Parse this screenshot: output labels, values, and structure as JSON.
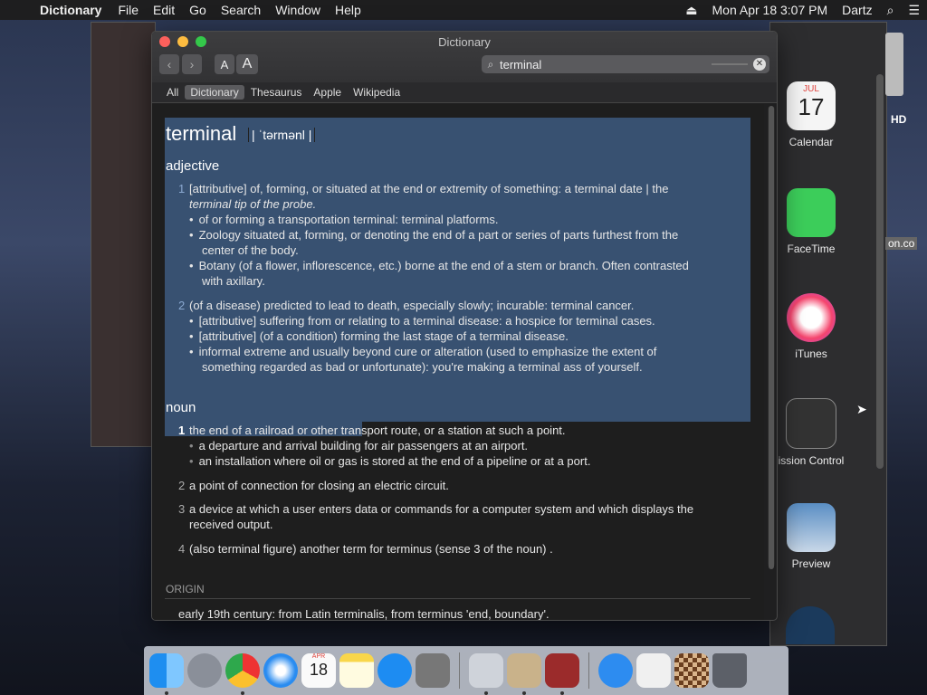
{
  "menubar": {
    "app_name": "Dictionary",
    "menus": [
      "File",
      "Edit",
      "Go",
      "Search",
      "Window",
      "Help"
    ],
    "datetime": "Mon Apr 18  3:07 PM",
    "user": "Dartz"
  },
  "window": {
    "title": "Dictionary",
    "font_small": "A",
    "font_large": "A",
    "search_value": "terminal",
    "tabs": [
      "All",
      "Dictionary",
      "Thesaurus",
      "Apple",
      "Wikipedia"
    ]
  },
  "entry": {
    "headword": "terminal",
    "pronunciation": "| ˈtərmənl |",
    "adjective_label": "adjective",
    "adj_1_num": "1",
    "adj_1_a": "[attributive] of, forming, or situated at the end or extremity of something: a terminal date | the",
    "adj_1_b": "terminal tip of the probe.",
    "adj_1_s1": "of or forming a transportation terminal: terminal platforms.",
    "adj_1_s2a": "Zoology situated at, forming, or denoting the end of a part or series of parts furthest from the",
    "adj_1_s2b": "center of the body.",
    "adj_1_s3a": "Botany (of a flower, inflorescence, etc.) borne at the end of a stem or branch. Often contrasted",
    "adj_1_s3b": "with axillary.",
    "adj_2_num": "2",
    "adj_2_a": "(of a disease) predicted to lead to death, especially slowly; incurable: terminal cancer.",
    "adj_2_s1": "[attributive] suffering from or relating to a terminal disease: a hospice for terminal cases.",
    "adj_2_s2": "[attributive] (of a condition) forming the last stage of a terminal disease.",
    "adj_2_s3a": "informal extreme and usually beyond cure or alteration (used to emphasize the extent of",
    "adj_2_s3b": "something regarded as bad or unfortunate): you're making a terminal ass of yourself.",
    "noun_label": "noun",
    "n_1_num": "1",
    "n_1": "the end of a railroad or other transport route, or a station at such a point.",
    "n_1_s1": "a departure and arrival building for air passengers at an airport.",
    "n_1_s2": "an installation where oil or gas is stored at the end of a pipeline or at a port.",
    "n_2_num": "2",
    "n_2": "a point of connection for closing an electric circuit.",
    "n_3_num": "3",
    "n_3a": "a device at which a user enters data or commands for a computer system and which displays the",
    "n_3b": "received output.",
    "n_4_num": "4",
    "n_4": "(also terminal figure) another term for terminus (sense 3 of the noun) .",
    "origin_label": "ORIGIN",
    "origin": "early 19th century: from Latin terminalis, from terminus 'end, boundary'."
  },
  "apps_panel": [
    {
      "label": "Calendar",
      "icon": "calendar-icon",
      "calendar_month": "JUL",
      "calendar_day": "17"
    },
    {
      "label": "FaceTime",
      "icon": "facetime-icon"
    },
    {
      "label": "iTunes",
      "icon": "itunes-icon"
    },
    {
      "label": "ission Control",
      "icon": "mission-control-icon"
    },
    {
      "label": "Preview",
      "icon": "preview-icon"
    }
  ],
  "desktop": {
    "drive_label": "HD",
    "partial_label": "on.co"
  },
  "dock": {
    "calendar_month": "APR",
    "calendar_day": "18",
    "items": [
      "finder-icon",
      "launchpad-icon",
      "chrome-icon",
      "safari-icon",
      "calendar-icon",
      "notes-icon",
      "app-store-icon",
      "system-preferences-icon",
      "directory-utility-icon",
      "chess-icon",
      "dictionary-icon",
      "app-store-downloads-icon",
      "file-icon",
      "chess-board-icon",
      "trash-icon"
    ]
  },
  "colors": {
    "highlight": "#3d5a80",
    "accent_red": "#fc605c",
    "accent_yellow": "#fdbc40",
    "accent_green": "#34c84a"
  }
}
